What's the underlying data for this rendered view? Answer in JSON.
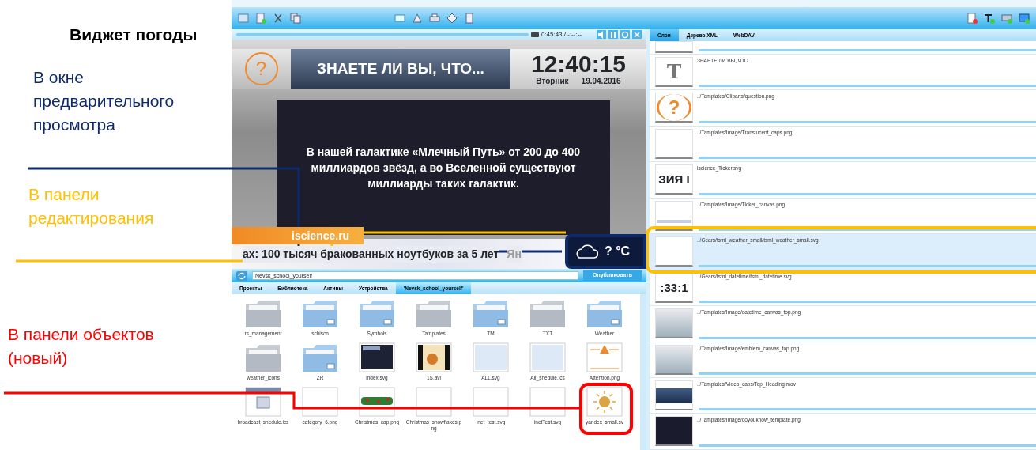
{
  "annotations": {
    "title": "Виджет погоды",
    "callouts": [
      {
        "text": "В окне предварительного просмотра",
        "color": "#0d2a6b"
      },
      {
        "text": "В панели редактирования",
        "color": "#ffc000"
      },
      {
        "text": "В панели объектов (новый)",
        "color": "#ff0000"
      }
    ]
  },
  "preview": {
    "question_mark": "?",
    "timecode": "0:45:43 / -:--:--",
    "headline": "ЗНАЕТЕ ЛИ ВЫ, ЧТО...",
    "clock": "12:40:15",
    "weekday": "Вторник",
    "date": "19.04.2016",
    "fact": "В нашей галактике «Млечный Путь» от 200 до 400 миллиардов звёзд, а во Вселенной существуют миллиарды таких галактик.",
    "site": "iscience.ru",
    "ticker": "ах: 100 тысяч бракованных ноутбуков за 5 лет",
    "ticker_tail": "Ян",
    "weather": "? °C"
  },
  "objects": {
    "project": "Nevsk_school_yourself",
    "publish": "Опубликовать",
    "tabs": [
      {
        "label": "Проекты",
        "selected": false
      },
      {
        "label": "Библиотека",
        "selected": false
      },
      {
        "label": "Активы",
        "selected": false
      },
      {
        "label": "Устройства",
        "selected": false
      },
      {
        "label": "'Nevsk_school_yourself'",
        "selected": true
      }
    ],
    "items": [
      {
        "name": "rs_management",
        "kind": "folder"
      },
      {
        "name": "schiscn",
        "kind": "linked-folder"
      },
      {
        "name": "Symbols",
        "kind": "linked-folder"
      },
      {
        "name": "Tamplates",
        "kind": "folder"
      },
      {
        "name": "TM",
        "kind": "linked-folder"
      },
      {
        "name": "TXT",
        "kind": "folder"
      },
      {
        "name": "Weather",
        "kind": "linked-folder"
      },
      {
        "name": "weather_icons",
        "kind": "folder"
      },
      {
        "name": "ZR",
        "kind": "linked-folder"
      },
      {
        "name": "index.svg",
        "kind": "dark-image"
      },
      {
        "name": "1S.avi",
        "kind": "video"
      },
      {
        "name": "ALL.svg",
        "kind": "light-image"
      },
      {
        "name": "All_shedule.ics",
        "kind": "light-image"
      },
      {
        "name": "Attention.png",
        "kind": "warning"
      },
      {
        "name": "broadcast_shedule.ics",
        "kind": "calendar"
      },
      {
        "name": "category_6.png",
        "kind": "blank"
      },
      {
        "name": "Christmas_cap.png",
        "kind": "garland"
      },
      {
        "name": "Christmas_snowflakes.png",
        "kind": "blank"
      },
      {
        "name": "inet_test.svg",
        "kind": "blank"
      },
      {
        "name": "inetTest.svg",
        "kind": "blank"
      },
      {
        "name": "yandex_small.sv",
        "kind": "sun"
      }
    ]
  },
  "layers": {
    "tabs": [
      {
        "label": "Слои",
        "selected": true
      },
      {
        "label": "Дерево XML",
        "selected": false
      },
      {
        "label": "WebDAV",
        "selected": false
      }
    ],
    "rows": [
      {
        "kind": "blank",
        "selected": false,
        "partial": true
      },
      {
        "path": "ЗНАЕТЕ ЛИ ВЫ, ЧТО...",
        "kind": "glyph",
        "glyph": "T",
        "selected": false,
        "partial": false
      },
      {
        "path": "../Tamplates/Cliparts/question.png",
        "kind": "question",
        "glyph": "?",
        "selected": false,
        "partial": false
      },
      {
        "path": "../Tamplates/Image/Translucent_caps.png",
        "kind": "blank",
        "selected": false,
        "partial": false
      },
      {
        "path": "iscience_Ticker.svg",
        "kind": "glyph",
        "glyph": "ЗИЯ I",
        "selected": false,
        "partial": false
      },
      {
        "path": "../Tamplates/Image/Ticker_canvas.png",
        "kind": "stripe",
        "selected": false,
        "partial": false
      },
      {
        "path": "../Gears/tsml_weather_small/tsml_weather_small.svg",
        "kind": "blank",
        "selected": true,
        "partial": false
      },
      {
        "path": "../Gears/tsml_datetime/tsml_datetime.svg",
        "kind": "glyph",
        "glyph": ":33:1",
        "selected": false,
        "partial": false
      },
      {
        "path": "../Tamplates/Image/datetime_canvas_top.png",
        "kind": "grey",
        "selected": false,
        "partial": false
      },
      {
        "path": "../Tamplates/Image/emblem_canvas_top.png",
        "kind": "grey",
        "selected": false,
        "partial": false
      },
      {
        "path": "../Tamplates/Video_caps/Top_Heading.mov",
        "kind": "navy",
        "selected": false,
        "partial": false
      },
      {
        "path": "../Tamplates/Image/doyouknow_template.png",
        "kind": "dark",
        "selected": false,
        "partial": false
      }
    ]
  }
}
